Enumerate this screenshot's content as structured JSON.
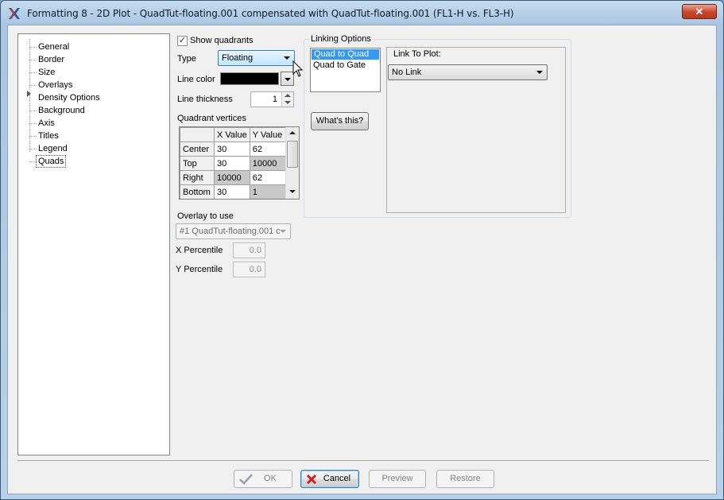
{
  "window": {
    "title": "Formatting 8 - 2D Plot - QuadTut-floating.001 compensated with QuadTut-floating.001 (FL1-H vs. FL3-H)",
    "close_glyph": "✕"
  },
  "tree": {
    "items": [
      "General",
      "Border",
      "Size",
      "Overlays",
      "Density Options",
      "Background",
      "Axis",
      "Titles",
      "Legend",
      "Quads"
    ],
    "selected": "Quads"
  },
  "quads": {
    "show_quadrants_label": "Show quadrants",
    "show_quadrants_checked": "✓",
    "type_label": "Type",
    "type_value": "Floating",
    "line_color_label": "Line color",
    "line_color_value": "#000000",
    "line_thickness_label": "Line thickness",
    "line_thickness_value": "1",
    "vertices_label": "Quadrant vertices",
    "vertices_table": {
      "columns": [
        "",
        "X Value",
        "Y Value"
      ],
      "rows": [
        {
          "name": "Center",
          "x": "30",
          "y": "62"
        },
        {
          "name": "Top",
          "x": "30",
          "y": "10000"
        },
        {
          "name": "Right",
          "x": "10000",
          "y": "62"
        },
        {
          "name": "Bottom",
          "x": "30",
          "y": "1"
        }
      ]
    },
    "overlay_label": "Overlay to use",
    "overlay_value": "#1 QuadTut-floating.001 c",
    "x_percentile_label": "X Percentile",
    "x_percentile_value": "0.0",
    "y_percentile_label": "Y Percentile",
    "y_percentile_value": "0.0"
  },
  "linking": {
    "label": "Linking Options",
    "options": [
      "Quad to Quad",
      "Quad to Gate"
    ],
    "selected": "Quad to Quad",
    "link_to_plot_label": "Link To Plot:",
    "link_to_plot_value": "No Link",
    "whats_this_label": "What's this?"
  },
  "footer": {
    "ok_label": "OK",
    "cancel_label": "Cancel",
    "preview_label": "Preview",
    "restore_label": "Restore"
  },
  "colors": {
    "selection": "#3399ff",
    "cancel_x": "#cc1e1e",
    "ok_check": "#9aa0a4"
  }
}
